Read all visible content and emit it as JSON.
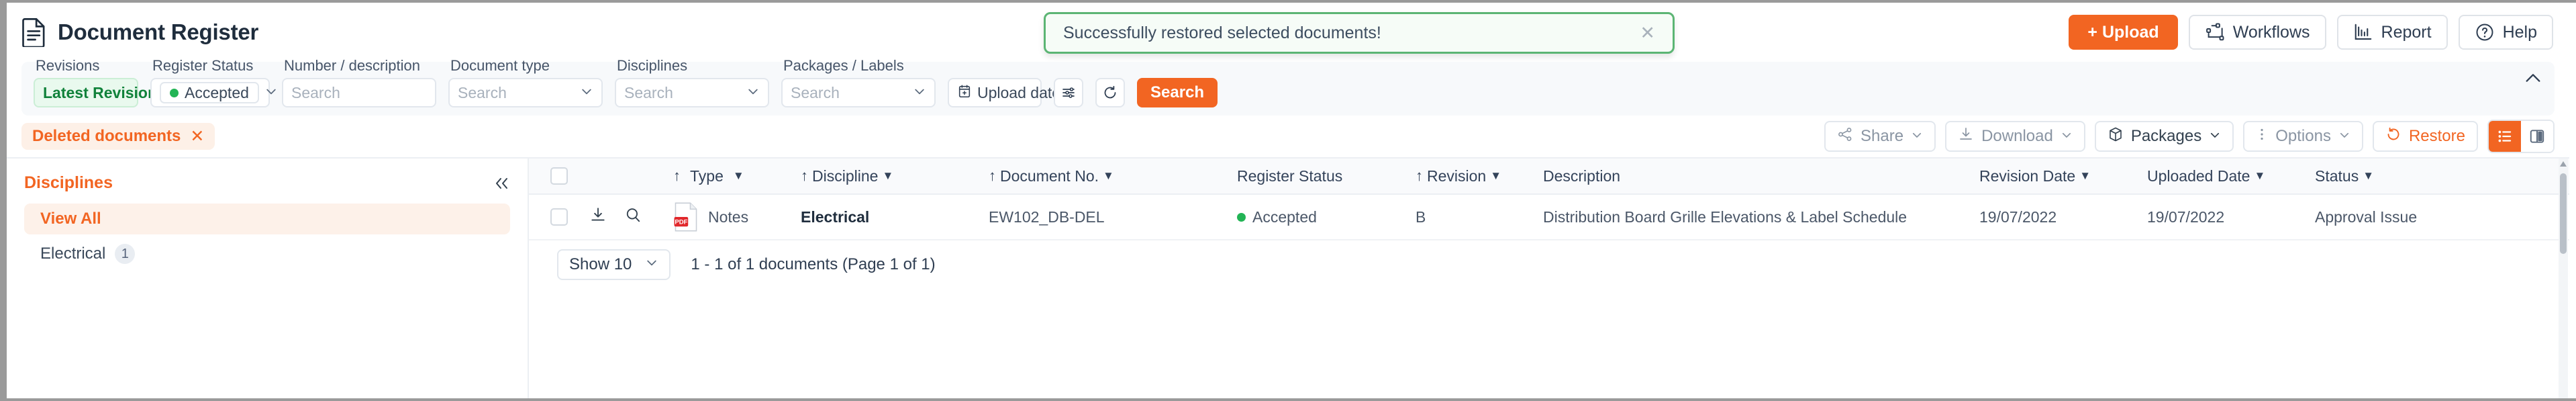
{
  "header": {
    "title": "Document Register",
    "doc_icon": "document-icon",
    "actions": [
      {
        "label": "+ Upload",
        "icon": "upload-icon",
        "primary": true
      },
      {
        "label": "Workflows",
        "icon": "workflows-icon",
        "primary": false
      },
      {
        "label": "Report",
        "icon": "report-chart-icon",
        "primary": false
      },
      {
        "label": "Help",
        "icon": "help-circle-icon",
        "primary": false
      }
    ]
  },
  "toast": {
    "message": "Successfully restored selected documents!",
    "close_icon": "close-icon",
    "border_color": "#5cb574",
    "background_color": "#f6fcf7"
  },
  "filters": {
    "revisions": {
      "label": "Revisions",
      "value": "Latest Revisions"
    },
    "register_status": {
      "label": "Register Status",
      "value": "Accepted",
      "dot_color": "#22b455"
    },
    "number_description": {
      "label": "Number / description",
      "value": "",
      "placeholder": "Search"
    },
    "document_type": {
      "label": "Document type",
      "value": "",
      "placeholder": "Search"
    },
    "disciplines": {
      "label": "Disciplines",
      "value": "",
      "placeholder": "Search"
    },
    "packages_labels": {
      "label": "Packages / Labels",
      "value": "",
      "placeholder": "Search"
    },
    "date_filter": {
      "value": "Upload date",
      "icon": "calendar-plus-icon"
    },
    "settings_icon": "sliders-icon",
    "reset_icon": "refresh-icon",
    "search_button": "Search",
    "collapse_icon": "chevron-up-icon"
  },
  "chips": [
    {
      "label": "Deleted documents",
      "close_icon": "close-icon"
    }
  ],
  "toolbar": {
    "buttons": [
      {
        "label": "Share",
        "icon": "share-icon",
        "caret": true,
        "style": "muted"
      },
      {
        "label": "Download",
        "icon": "download-icon",
        "caret": true,
        "style": "muted"
      },
      {
        "label": "Packages",
        "icon": "package-box-icon",
        "caret": true,
        "style": "dark"
      },
      {
        "label": "Options",
        "icon": "kebab-menu-icon",
        "caret": true,
        "style": "muted"
      },
      {
        "label": "Restore",
        "icon": "restore-icon",
        "caret": false,
        "style": "restore"
      }
    ],
    "view_toggle": [
      {
        "name": "list-view",
        "icon": "list-view-icon",
        "active": true
      },
      {
        "name": "split-view",
        "icon": "split-view-icon",
        "active": false
      }
    ]
  },
  "sidebar": {
    "title": "Disciplines",
    "collapse_icon": "chevron-double-left-icon",
    "items": [
      {
        "label": "View All",
        "count": "",
        "active": true
      },
      {
        "label": "Electrical",
        "count": "1",
        "active": false
      }
    ]
  },
  "table": {
    "columns": [
      {
        "key": "check",
        "label": "",
        "sortable": false,
        "filter": false
      },
      {
        "key": "act",
        "label": "",
        "sortable": false,
        "filter": false
      },
      {
        "key": "type",
        "label": "Type",
        "sortable": true,
        "filter": true
      },
      {
        "key": "disc",
        "label": "Discipline",
        "sortable": true,
        "filter": true
      },
      {
        "key": "num",
        "label": "Document No.",
        "sortable": true,
        "filter": true
      },
      {
        "key": "reg",
        "label": "Register Status",
        "sortable": false,
        "filter": false
      },
      {
        "key": "rev",
        "label": "Revision",
        "sortable": true,
        "filter": true
      },
      {
        "key": "desc",
        "label": "Description",
        "sortable": false,
        "filter": false
      },
      {
        "key": "rdate",
        "label": "Revision Date",
        "sortable": false,
        "filter": true
      },
      {
        "key": "udate",
        "label": "Uploaded Date",
        "sortable": false,
        "filter": true
      },
      {
        "key": "stat",
        "label": "Status",
        "sortable": false,
        "filter": true
      }
    ],
    "rows": [
      {
        "type_badge": "PDF",
        "type": "Notes",
        "discipline": "Electrical",
        "document_no": "EW102_DB-DEL",
        "register_status": "Accepted",
        "register_status_color": "#22b455",
        "revision": "B",
        "description": "Distribution Board Grille Elevations & Label Schedule",
        "revision_date": "19/07/2022",
        "uploaded_date": "19/07/2022",
        "status": "Approval Issue",
        "download_icon": "download-icon",
        "preview_icon": "search-icon"
      }
    ]
  },
  "footer": {
    "page_size": "Show 10",
    "summary": "1 - 1 of 1 documents (Page 1 of 1)"
  },
  "colors": {
    "accent": "#f26522",
    "success": "#22b455",
    "text": "#2f3e52"
  }
}
